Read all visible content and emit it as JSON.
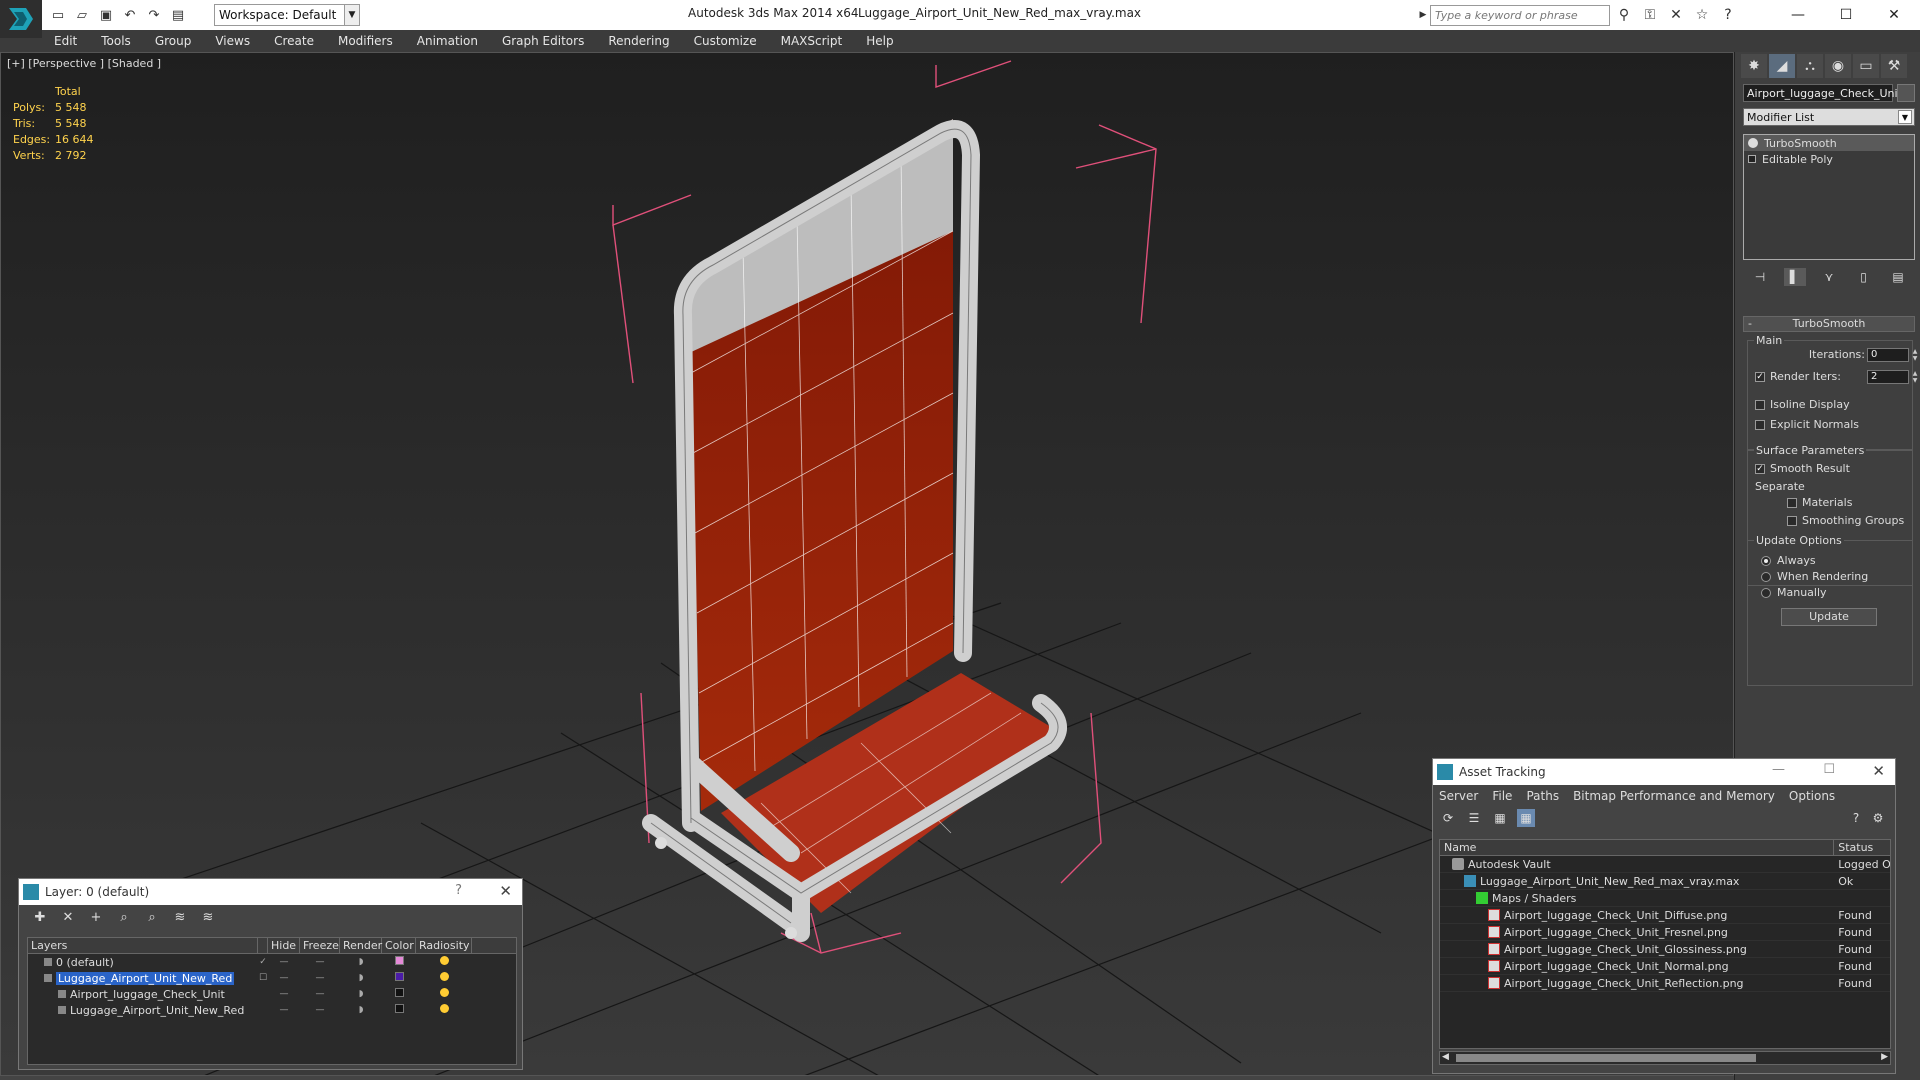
{
  "window": {
    "app_title": "Autodesk 3ds Max  2014 x64",
    "file_title": "Luggage_Airport_Unit_New_Red_max_vray.max",
    "workspace_label": "Workspace: Default",
    "search_placeholder": "Type a keyword or phrase"
  },
  "menu": [
    "Edit",
    "Tools",
    "Group",
    "Views",
    "Create",
    "Modifiers",
    "Animation",
    "Graph Editors",
    "Rendering",
    "Customize",
    "MAXScript",
    "Help"
  ],
  "viewport": {
    "label": "[+] [Perspective ] [Shaded ]",
    "stats": {
      "header": "Total",
      "polys_label": "Polys:",
      "polys": "5 548",
      "tris_label": "Tris:",
      "tris": "5 548",
      "edges_label": "Edges:",
      "edges": "16 644",
      "verts_label": "Verts:",
      "verts": "2 792"
    },
    "colors": {
      "background": "#2b2b2b",
      "panel_red": "#8f1a06",
      "frame": "#b8b8b8",
      "bbox": "#e0507a"
    }
  },
  "command_panel": {
    "object_name": "Airport_luggage_Check_Unit",
    "modifier_list": "Modifier List",
    "stack": [
      "TurboSmooth",
      "Editable Poly"
    ],
    "rollout_title": "TurboSmooth",
    "main_group": "Main",
    "iterations_label": "Iterations:",
    "iterations_value": "0",
    "render_iters_label": "Render Iters:",
    "render_iters_value": "2",
    "render_iters_checked": true,
    "isoline_label": "Isoline Display",
    "explicit_normals_label": "Explicit Normals",
    "surface_group": "Surface Parameters",
    "smooth_result_label": "Smooth Result",
    "separate_label": "Separate",
    "materials_label": "Materials",
    "smoothing_groups_label": "Smoothing Groups",
    "update_group": "Update Options",
    "update_always": "Always",
    "update_rendering": "When Rendering",
    "update_manually": "Manually",
    "update_button": "Update"
  },
  "layer_dialog": {
    "title": "Layer: 0 (default)",
    "help": "?",
    "columns": [
      "Layers",
      "Hide",
      "Freeze",
      "Render",
      "Color",
      "Radiosity"
    ],
    "rows": [
      {
        "name": "0 (default)",
        "color": "#e58ad8",
        "selected": false
      },
      {
        "name": "Luggage_Airport_Unit_New_Red",
        "color": "#4b1ca8",
        "selected": true
      },
      {
        "name": "Airport_luggage_Check_Unit",
        "color": "#111111",
        "selected": false
      },
      {
        "name": "Luggage_Airport_Unit_New_Red",
        "color": "#111111",
        "selected": false
      }
    ]
  },
  "asset_tracking": {
    "title": "Asset Tracking",
    "menu": [
      "Server",
      "File",
      "Paths",
      "Bitmap Performance and Memory",
      "Options"
    ],
    "columns": [
      "Name",
      "Status"
    ],
    "rows": [
      {
        "name": "Autodesk Vault",
        "status": "Logged Out",
        "indent": 1,
        "icon": "vault-icon"
      },
      {
        "name": "Luggage_Airport_Unit_New_Red_max_vray.max",
        "status": "Ok",
        "indent": 2,
        "icon": "max-file-icon"
      },
      {
        "name": "Maps / Shaders",
        "status": "",
        "indent": 3,
        "icon": "maps-icon"
      },
      {
        "name": "Airport_luggage_Check_Unit_Diffuse.png",
        "status": "Found",
        "indent": 4,
        "icon": "png-icon"
      },
      {
        "name": "Airport_luggage_Check_Unit_Fresnel.png",
        "status": "Found",
        "indent": 4,
        "icon": "png-icon"
      },
      {
        "name": "Airport_luggage_Check_Unit_Glossiness.png",
        "status": "Found",
        "indent": 4,
        "icon": "png-icon"
      },
      {
        "name": "Airport_luggage_Check_Unit_Normal.png",
        "status": "Found",
        "indent": 4,
        "icon": "png-icon"
      },
      {
        "name": "Airport_luggage_Check_Unit_Reflection.png",
        "status": "Found",
        "indent": 4,
        "icon": "png-icon"
      }
    ]
  }
}
